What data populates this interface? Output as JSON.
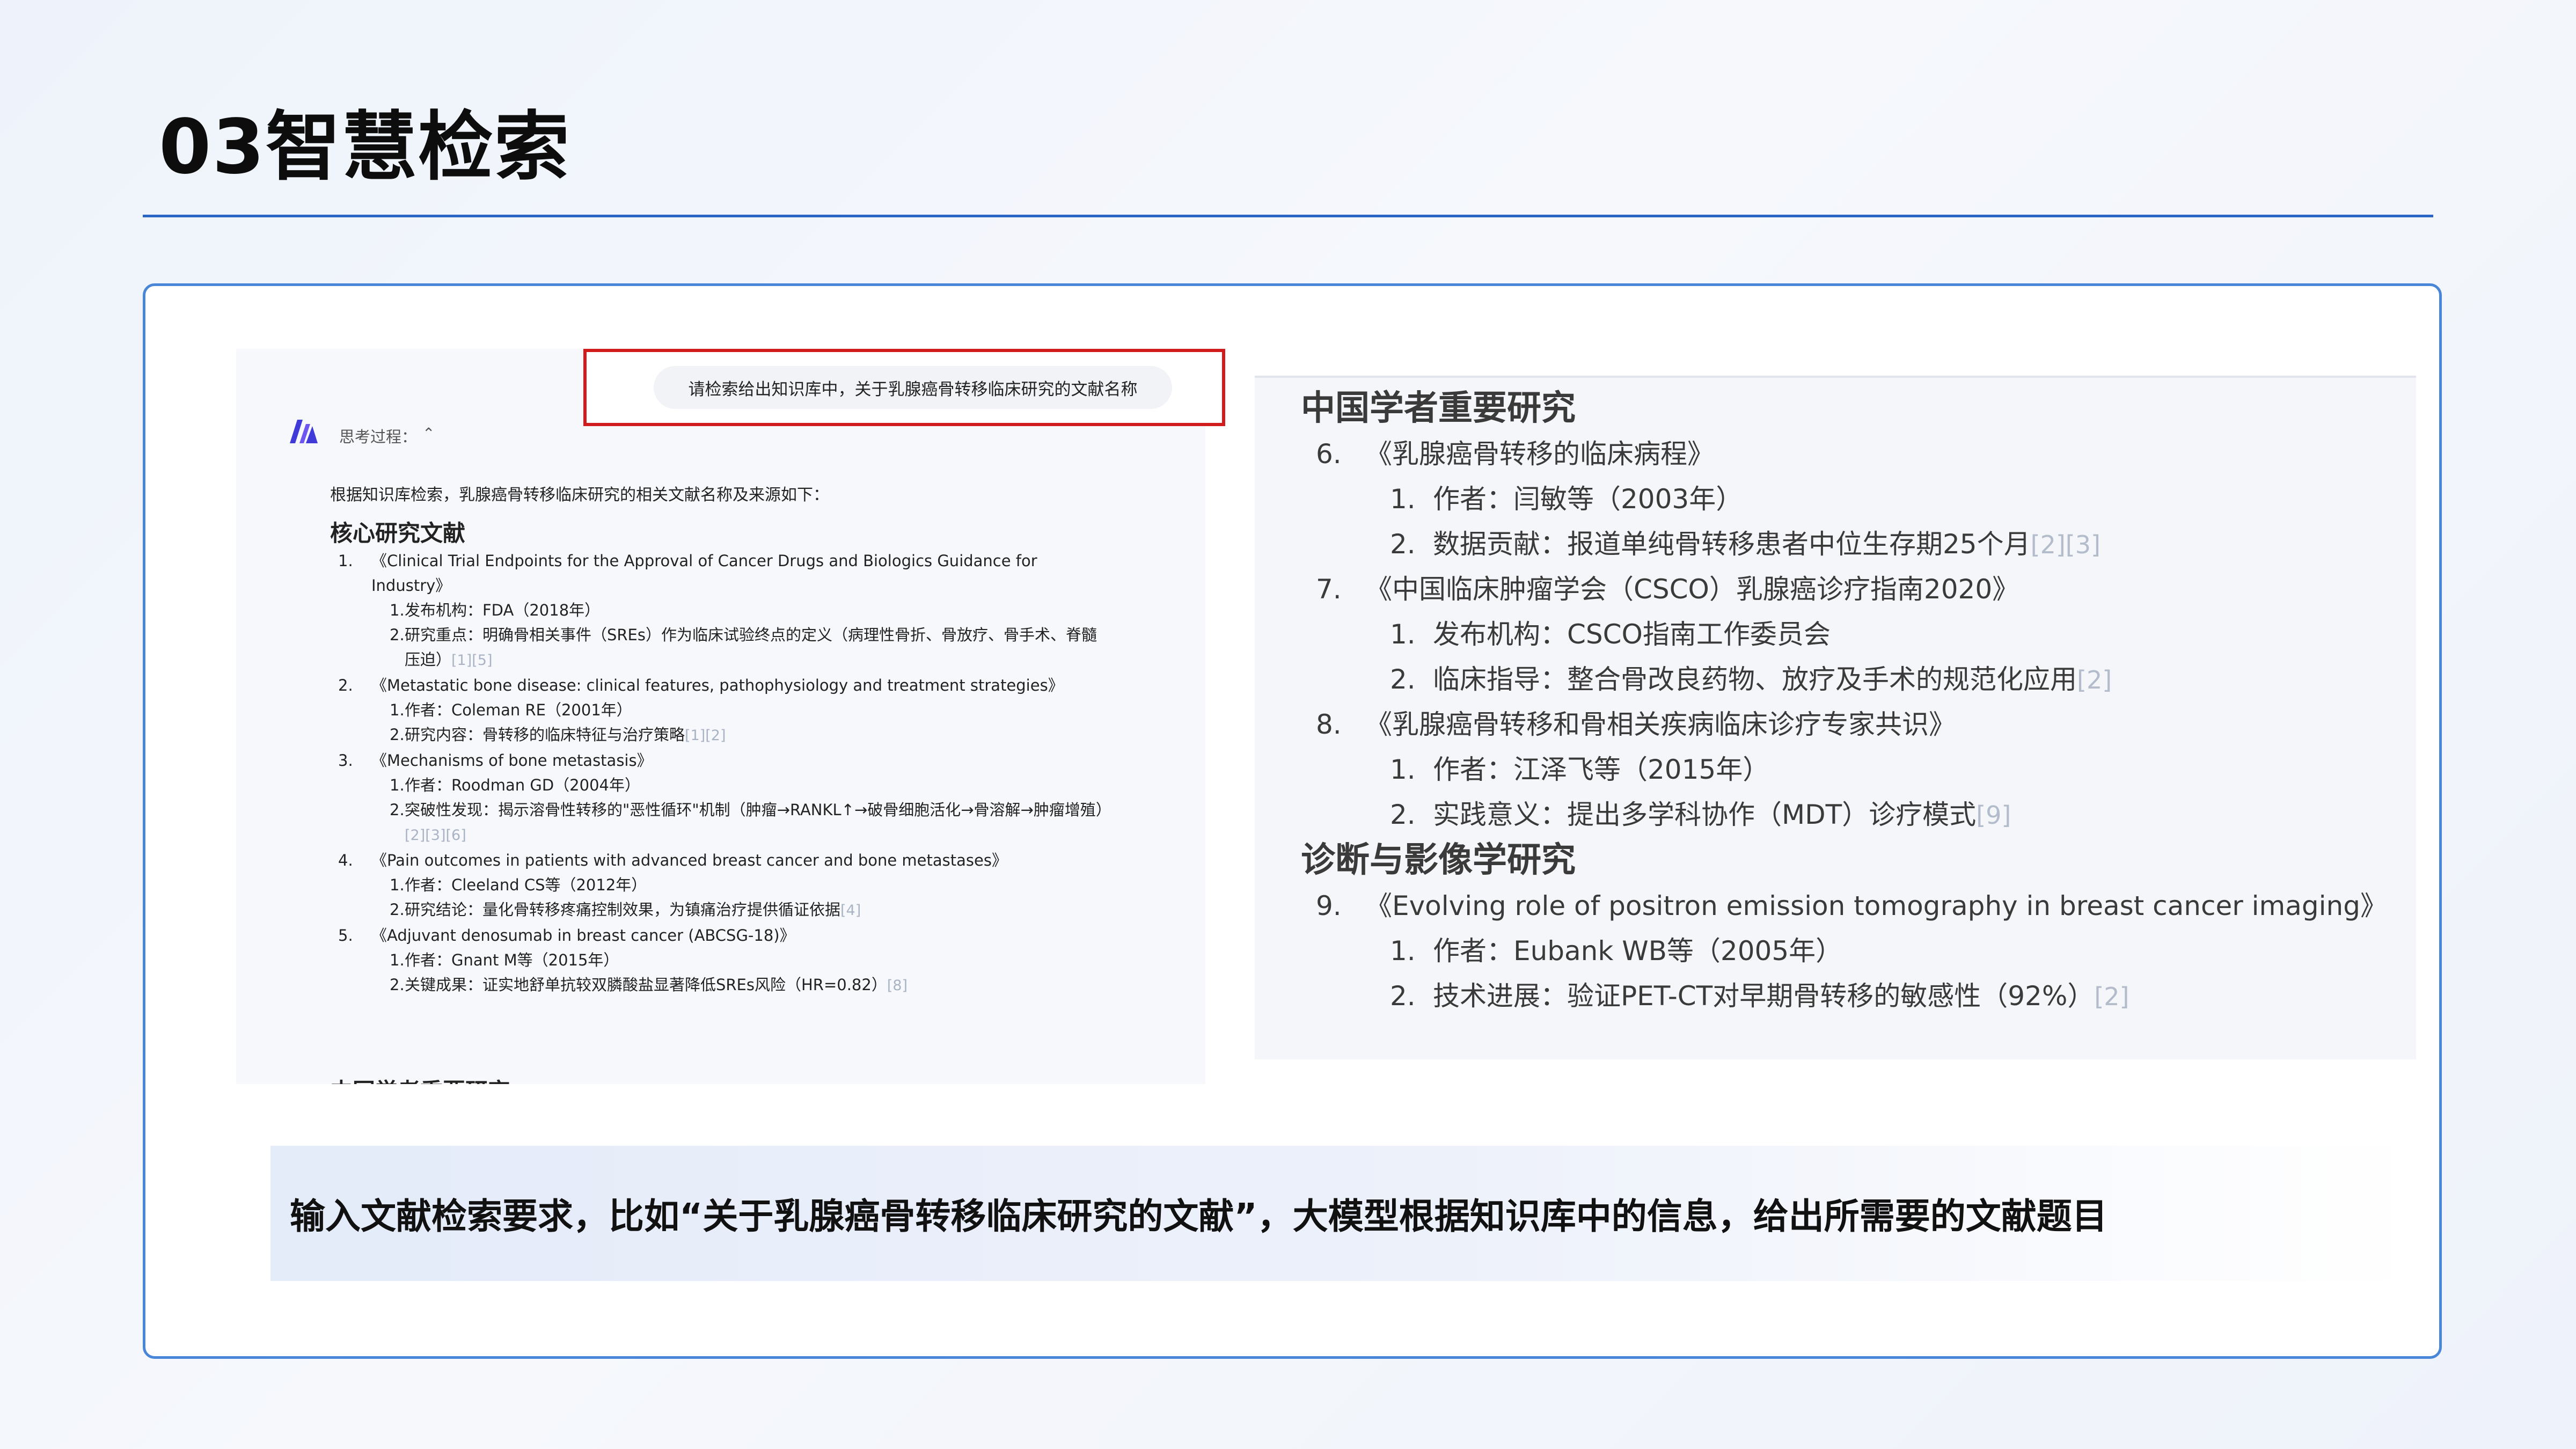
{
  "slide": {
    "title": "03智慧检索",
    "caption": "输入文献检索要求，比如“关于乳腺癌骨转移临床研究的文献”，大模型根据知识库中的信息，给出所需要的文献题目"
  },
  "chat": {
    "query": "请检索给出知识库中，关于乳腺癌骨转移临床研究的文献名称",
    "thinking_label": "思考过程：",
    "intro": "根据知识库检索，乳腺癌骨转移临床研究的相关文献名称及来源如下：",
    "heading": "核心研究文献",
    "items": [
      {
        "num": "1.",
        "title": "《Clinical Trial Endpoints for the Approval of Cancer Drugs and Biologics Guidance for Industry》",
        "subs": [
          {
            "num": "1.",
            "text": "发布机构：FDA（2018年）",
            "ref": ""
          },
          {
            "num": "2.",
            "text": "研究重点：明确骨相关事件（SREs）作为临床试验终点的定义（病理性骨折、骨放疗、骨手术、脊髓压迫）",
            "ref": "[1][5]"
          }
        ]
      },
      {
        "num": "2.",
        "title": "《Metastatic bone disease: clinical features, pathophysiology and treatment strategies》",
        "subs": [
          {
            "num": "1.",
            "text": "作者：Coleman RE（2001年）",
            "ref": ""
          },
          {
            "num": "2.",
            "text": "研究内容：骨转移的临床特征与治疗策略",
            "ref": "[1][2]"
          }
        ]
      },
      {
        "num": "3.",
        "title": "《Mechanisms of bone metastasis》",
        "subs": [
          {
            "num": "1.",
            "text": "作者：Roodman GD（2004年）",
            "ref": ""
          },
          {
            "num": "2.",
            "text": "突破性发现：揭示溶骨性转移的\"恶性循环\"机制（肿瘤→RANKL↑→破骨细胞活化→骨溶解→肿瘤增殖）",
            "ref": "[2][3][6]"
          }
        ]
      },
      {
        "num": "4.",
        "title": "《Pain outcomes in patients with advanced breast cancer and bone metastases》",
        "subs": [
          {
            "num": "1.",
            "text": "作者：Cleeland CS等（2012年）",
            "ref": ""
          },
          {
            "num": "2.",
            "text": "研究结论：量化骨转移疼痛控制效果，为镇痛治疗提供循证依据",
            "ref": "[4]"
          }
        ]
      },
      {
        "num": "5.",
        "title": "《Adjuvant denosumab in breast cancer (ABCSG-18)》",
        "subs": [
          {
            "num": "1.",
            "text": "作者：Gnant M等（2015年）",
            "ref": ""
          },
          {
            "num": "2.",
            "text": "关键成果：证实地舒单抗较双膦酸盐显著降低SREs风险（HR=0.82）",
            "ref": "[8]"
          }
        ]
      }
    ],
    "cut_heading": "中国学者重要研究"
  },
  "zoom": {
    "sections": [
      {
        "heading": "中国学者重要研究",
        "items": [
          {
            "num": "6.",
            "title": "《乳腺癌骨转移的临床病程》",
            "subs": [
              {
                "num": "1.",
                "text": "作者：闫敏等（2003年）",
                "ref": ""
              },
              {
                "num": "2.",
                "text": "数据贡献：报道单纯骨转移患者中位生存期25个月",
                "ref": "[2][3]"
              }
            ]
          },
          {
            "num": "7.",
            "title": "《中国临床肿瘤学会（CSCO）乳腺癌诊疗指南2020》",
            "subs": [
              {
                "num": "1.",
                "text": "发布机构：CSCO指南工作委员会",
                "ref": ""
              },
              {
                "num": "2.",
                "text": "临床指导：整合骨改良药物、放疗及手术的规范化应用",
                "ref": "[2]"
              }
            ]
          },
          {
            "num": "8.",
            "title": "《乳腺癌骨转移和骨相关疾病临床诊疗专家共识》",
            "subs": [
              {
                "num": "1.",
                "text": "作者：江泽飞等（2015年）",
                "ref": ""
              },
              {
                "num": "2.",
                "text": "实践意义：提出多学科协作（MDT）诊疗模式",
                "ref": "[9]"
              }
            ]
          }
        ]
      },
      {
        "heading": "诊断与影像学研究",
        "items": [
          {
            "num": "9.",
            "title": "《Evolving role of positron emission tomography in breast cancer imaging》",
            "subs": [
              {
                "num": "1.",
                "text": "作者：Eubank WB等（2005年）",
                "ref": ""
              },
              {
                "num": "2.",
                "text": "技术进展：验证PET-CT对早期骨转移的敏感性（92%）",
                "ref": "[2]"
              }
            ]
          }
        ]
      }
    ]
  },
  "colors": {
    "accent": "#2b66c4",
    "highlight_box": "#d01c1c",
    "reference": "#a9b3c4"
  },
  "icons": {
    "logo": "ai-logo-icon",
    "collapse": "chevron-up-icon"
  }
}
